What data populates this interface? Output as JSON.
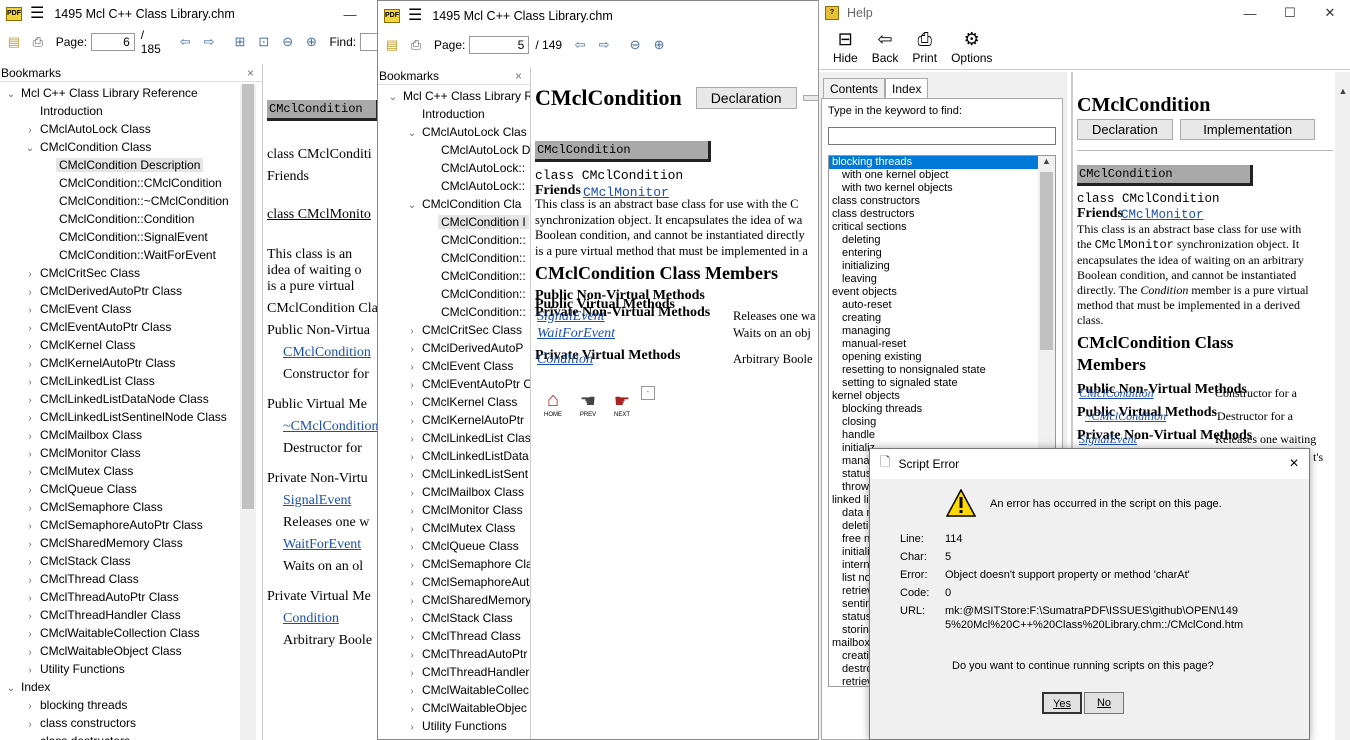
{
  "w1": {
    "title": "1495 Mcl C++ Class Library.chm",
    "page_label": "Page:",
    "page_value": "6",
    "page_of": "/ 185",
    "find_label": "Find:",
    "bookmarks_label": "Bookmarks",
    "close": "×",
    "tree": [
      {
        "l": "Mcl C++ Class Library Reference",
        "d": 0,
        "t": "⌄"
      },
      {
        "l": "Introduction",
        "d": 1,
        "t": ""
      },
      {
        "l": "CMclAutoLock Class",
        "d": 1,
        "t": "›"
      },
      {
        "l": "CMclCondition Class",
        "d": 1,
        "t": "⌄"
      },
      {
        "l": "CMclCondition Description",
        "d": 2,
        "t": "",
        "s": true
      },
      {
        "l": "CMclCondition::CMclCondition",
        "d": 2,
        "t": ""
      },
      {
        "l": "CMclCondition::~CMclCondition",
        "d": 2,
        "t": ""
      },
      {
        "l": "CMclCondition::Condition",
        "d": 2,
        "t": ""
      },
      {
        "l": "CMclCondition::SignalEvent",
        "d": 2,
        "t": ""
      },
      {
        "l": "CMclCondition::WaitForEvent",
        "d": 2,
        "t": ""
      },
      {
        "l": "CMclCritSec Class",
        "d": 1,
        "t": "›"
      },
      {
        "l": "CMclDerivedAutoPtr Class",
        "d": 1,
        "t": "›"
      },
      {
        "l": "CMclEvent Class",
        "d": 1,
        "t": "›"
      },
      {
        "l": "CMclEventAutoPtr Class",
        "d": 1,
        "t": "›"
      },
      {
        "l": "CMclKernel Class",
        "d": 1,
        "t": "›"
      },
      {
        "l": "CMclKernelAutoPtr Class",
        "d": 1,
        "t": "›"
      },
      {
        "l": "CMclLinkedList Class",
        "d": 1,
        "t": "›"
      },
      {
        "l": "CMclLinkedListDataNode Class",
        "d": 1,
        "t": "›"
      },
      {
        "l": "CMclLinkedListSentinelNode Class",
        "d": 1,
        "t": "›"
      },
      {
        "l": "CMclMailbox Class",
        "d": 1,
        "t": "›"
      },
      {
        "l": "CMclMonitor Class",
        "d": 1,
        "t": "›"
      },
      {
        "l": "CMclMutex Class",
        "d": 1,
        "t": "›"
      },
      {
        "l": "CMclQueue Class",
        "d": 1,
        "t": "›"
      },
      {
        "l": "CMclSemaphore Class",
        "d": 1,
        "t": "›"
      },
      {
        "l": "CMclSemaphoreAutoPtr Class",
        "d": 1,
        "t": "›"
      },
      {
        "l": "CMclSharedMemory Class",
        "d": 1,
        "t": "›"
      },
      {
        "l": "CMclStack Class",
        "d": 1,
        "t": "›"
      },
      {
        "l": "CMclThread Class",
        "d": 1,
        "t": "›"
      },
      {
        "l": "CMclThreadAutoPtr Class",
        "d": 1,
        "t": "›"
      },
      {
        "l": "CMclThreadHandler Class",
        "d": 1,
        "t": "›"
      },
      {
        "l": "CMclWaitableCollection Class",
        "d": 1,
        "t": "›"
      },
      {
        "l": "CMclWaitableObject Class",
        "d": 1,
        "t": "›"
      },
      {
        "l": "Utility Functions",
        "d": 1,
        "t": "›"
      },
      {
        "l": "Index",
        "d": 0,
        "t": "⌄"
      },
      {
        "l": "blocking threads",
        "d": 1,
        "t": "›"
      },
      {
        "l": "class constructors",
        "d": 1,
        "t": "›"
      },
      {
        "l": "class destructors",
        "d": 1,
        "t": "›"
      }
    ],
    "content": {
      "bar": "CMclCondition",
      "line1": "class CMclConditi",
      "friends": "Friends",
      "line2": "class CMclMonito",
      "para1": "This class is an",
      "para2": "idea of waiting o",
      "para3": "is a pure virtual",
      "members": "CMclCondition Cla",
      "pnv": "Public Non-Virtua",
      "l_cmcl": "CMclCondition",
      "d_ctor": "Constructor for",
      "pv": "Public Virtual Me",
      "l_dtor": "~CMclCondition",
      "d_dtor": "Destructor for",
      "prnv": "Private Non-Virtu",
      "l_sig": "SignalEvent",
      "d_sig": "Releases one w",
      "l_wait": "WaitForEvent",
      "d_wait": "Waits on an ol",
      "prv": "Private Virtual Me",
      "l_cond": "Condition",
      "d_cond": "Arbitrary Boole"
    }
  },
  "w2": {
    "title": "1495 Mcl C++ Class Library.chm",
    "page_label": "Page:",
    "page_value": "5",
    "page_of": "/ 149",
    "bookmarks_label": "Bookmarks",
    "close": "×",
    "tree": [
      {
        "l": "Mcl C++ Class Library R",
        "d": 0,
        "t": "⌄"
      },
      {
        "l": "Introduction",
        "d": 1,
        "t": ""
      },
      {
        "l": "CMclAutoLock Clas",
        "d": 1,
        "t": "⌄"
      },
      {
        "l": "CMclAutoLock D",
        "d": 2,
        "t": ""
      },
      {
        "l": "CMclAutoLock::",
        "d": 2,
        "t": ""
      },
      {
        "l": "CMclAutoLock::",
        "d": 2,
        "t": ""
      },
      {
        "l": "CMclCondition Cla",
        "d": 1,
        "t": "⌄"
      },
      {
        "l": "CMclCondition I",
        "d": 2,
        "t": "",
        "s": true
      },
      {
        "l": "CMclCondition::",
        "d": 2,
        "t": ""
      },
      {
        "l": "CMclCondition::",
        "d": 2,
        "t": ""
      },
      {
        "l": "CMclCondition::",
        "d": 2,
        "t": ""
      },
      {
        "l": "CMclCondition::",
        "d": 2,
        "t": ""
      },
      {
        "l": "CMclCondition::",
        "d": 2,
        "t": ""
      },
      {
        "l": "CMclCritSec Class",
        "d": 1,
        "t": "›"
      },
      {
        "l": "CMclDerivedAutoP",
        "d": 1,
        "t": "›"
      },
      {
        "l": "CMclEvent Class",
        "d": 1,
        "t": "›"
      },
      {
        "l": "CMclEventAutoPtr C",
        "d": 1,
        "t": "›"
      },
      {
        "l": "CMclKernel Class",
        "d": 1,
        "t": "›"
      },
      {
        "l": "CMclKernelAutoPtr",
        "d": 1,
        "t": "›"
      },
      {
        "l": "CMclLinkedList Clas",
        "d": 1,
        "t": "›"
      },
      {
        "l": "CMclLinkedListData",
        "d": 1,
        "t": "›"
      },
      {
        "l": "CMclLinkedListSent",
        "d": 1,
        "t": "›"
      },
      {
        "l": "CMclMailbox Class",
        "d": 1,
        "t": "›"
      },
      {
        "l": "CMclMonitor Class",
        "d": 1,
        "t": "›"
      },
      {
        "l": "CMclMutex Class",
        "d": 1,
        "t": "›"
      },
      {
        "l": "CMclQueue Class",
        "d": 1,
        "t": "›"
      },
      {
        "l": "CMclSemaphore Cla",
        "d": 1,
        "t": "›"
      },
      {
        "l": "CMclSemaphoreAut",
        "d": 1,
        "t": "›"
      },
      {
        "l": "CMclSharedMemory",
        "d": 1,
        "t": "›"
      },
      {
        "l": "CMclStack Class",
        "d": 1,
        "t": "›"
      },
      {
        "l": "CMclThread Class",
        "d": 1,
        "t": "›"
      },
      {
        "l": "CMclThreadAutoPtr",
        "d": 1,
        "t": "›"
      },
      {
        "l": "CMclThreadHandler",
        "d": 1,
        "t": "›"
      },
      {
        "l": "CMclWaitableCollec",
        "d": 1,
        "t": "›"
      },
      {
        "l": "CMclWaitableObjec",
        "d": 1,
        "t": "›"
      },
      {
        "l": "Utility Functions",
        "d": 1,
        "t": "›"
      }
    ],
    "content": {
      "h1": "CMclCondition",
      "decl_btn": "Declaration",
      "bar": "CMclCondition",
      "class_line": "class CMclCondition",
      "friends": "Friends",
      "friend_link": "CMclMonitor",
      "p1": "This class is an abstract base class for use with the C",
      "p2": "synchronization object. It encapsulates the idea of wa",
      "p3": "Boolean condition, and cannot be instantiated directly",
      "p4": "is a pure virtual method that must be implemented in a",
      "h2": "CMclCondition Class Members",
      "pnv": "Public Non-Virtual Methods",
      "pv": "Public Virtual Methods",
      "prnv": "Private Non-Virtual Methods",
      "l_sig": "SignalEvent",
      "d_sig": "Releases one wa",
      "l_wait": "WaitForEvent",
      "d_wait": "Waits on an obj",
      "prv": "Private Virtual Methods",
      "l_cond": "Condition",
      "d_cond": "Arbitrary Boole",
      "nav_home": "HOME",
      "nav_prev": "PREV",
      "nav_next": "NEXT"
    }
  },
  "help": {
    "title": "Help",
    "tools": [
      "Hide",
      "Back",
      "Print",
      "Options"
    ],
    "tab_contents": "Contents",
    "tab_index": "Index",
    "kw_label": "Type in the keyword to find:",
    "list": [
      {
        "l": "blocking threads",
        "i": 0,
        "s": true
      },
      {
        "l": "with one kernel object",
        "i": 1
      },
      {
        "l": "with two kernel objects",
        "i": 1
      },
      {
        "l": "class constructors",
        "i": 0
      },
      {
        "l": "class destructors",
        "i": 0
      },
      {
        "l": "critical sections",
        "i": 0
      },
      {
        "l": "deleting",
        "i": 1
      },
      {
        "l": "entering",
        "i": 1
      },
      {
        "l": "initializing",
        "i": 1
      },
      {
        "l": "leaving",
        "i": 1
      },
      {
        "l": "event objects",
        "i": 0
      },
      {
        "l": "auto-reset",
        "i": 1
      },
      {
        "l": "creating",
        "i": 1
      },
      {
        "l": "managing",
        "i": 1
      },
      {
        "l": "manual-reset",
        "i": 1
      },
      {
        "l": "opening existing",
        "i": 1
      },
      {
        "l": "resetting to nonsignaled state",
        "i": 1
      },
      {
        "l": "setting to signaled state",
        "i": 1
      },
      {
        "l": "kernel objects",
        "i": 0
      },
      {
        "l": "blocking threads",
        "i": 1
      },
      {
        "l": "closing",
        "i": 1
      },
      {
        "l": "handle",
        "i": 1
      },
      {
        "l": "initializ",
        "i": 1
      },
      {
        "l": "manag",
        "i": 1
      },
      {
        "l": "status",
        "i": 1
      },
      {
        "l": "throwi",
        "i": 1
      },
      {
        "l": "linked list",
        "i": 0
      },
      {
        "l": "data n",
        "i": 1
      },
      {
        "l": "deletin",
        "i": 1
      },
      {
        "l": "free no",
        "i": 1
      },
      {
        "l": "initializ",
        "i": 1
      },
      {
        "l": "interna",
        "i": 1
      },
      {
        "l": "list no",
        "i": 1
      },
      {
        "l": "retriev",
        "i": 1
      },
      {
        "l": "sentin",
        "i": 1
      },
      {
        "l": "status",
        "i": 1
      },
      {
        "l": "storing",
        "i": 1
      },
      {
        "l": "mailbox o",
        "i": 0
      },
      {
        "l": "creatin",
        "i": 1
      },
      {
        "l": "destro",
        "i": 1
      },
      {
        "l": "retriev",
        "i": 1
      }
    ],
    "content": {
      "h1": "CMclCondition",
      "decl_btn": "Declaration",
      "impl_btn": "Implementation",
      "bar": "CMclCondition",
      "class_line": "class CMclCondition",
      "friends": "Friends",
      "friend_link": "CMclMonitor",
      "p1": "This class is an abstract base class for use with",
      "p2a": "the ",
      "p2m": "CMclMonitor",
      "p2b": " synchronization object. It",
      "p3": "encapsulates the idea of waiting on an arbitrary",
      "p4": "Boolean condition, and cannot be instantiated",
      "p5a": "directly. The ",
      "p5i": "Condition",
      "p5b": " member is a pure virtual",
      "p6": "method that must be implemented in a derived",
      "p7": "class.",
      "h2a": "CMclCondition Class",
      "h2b": "Members",
      "pnv": "Public Non-Virtual Methods",
      "l_cmcl": "CMclCondition",
      "d_ctor": "Constructor for a",
      "pv": "Public Virtual Methods",
      "l_dtor": "~CMclCondition",
      "d_dtor": "Destructor for a",
      "prnv": "Private Non-Virtual Methods",
      "l_sig": "SignalEvent",
      "d_sig": "Releases one waiting",
      "d_tail": "t's"
    }
  },
  "dialog": {
    "title": "Script Error",
    "message": "An error has occurred in the script on this page.",
    "line_label": "Line:",
    "line_value": "114",
    "char_label": "Char:",
    "char_value": "5",
    "error_label": "Error:",
    "error_value": "Object doesn't support property or method 'charAt'",
    "code_label": "Code:",
    "code_value": "0",
    "url_label": "URL:",
    "url_value1": "mk:@MSITStore:F:\\SumatraPDF\\ISSUES\\github\\OPEN\\149",
    "url_value2": "5%20Mcl%20C++%20Class%20Library.chm::/CMclCond.htm",
    "question": "Do you want to continue running scripts on this page?",
    "yes": "Yes",
    "no": "No",
    "close": "×"
  }
}
